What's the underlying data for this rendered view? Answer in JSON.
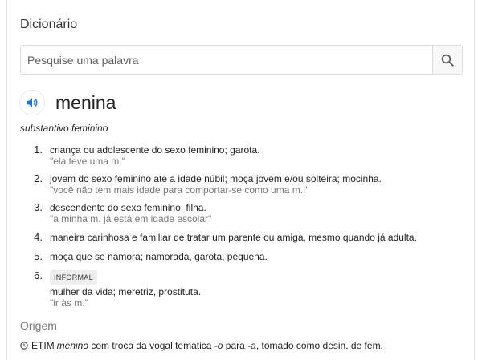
{
  "card": {
    "title": "Dicionário"
  },
  "search": {
    "placeholder": "Pesquise uma palavra",
    "button_icon": "search-icon"
  },
  "entry": {
    "speaker_icon": "speaker-icon",
    "word": "menina",
    "part_of_speech": "substantivo feminino",
    "senses": [
      {
        "num": "1.",
        "definition": "criança ou adolescente do sexo feminino; garota.",
        "example": "\"ela teve uma m.\""
      },
      {
        "num": "2.",
        "definition": "jovem do sexo feminino até a idade núbil; moça jovem e/ou solteira; mocinha.",
        "example": "\"você não tem mais idade para comportar-se como uma m.!\""
      },
      {
        "num": "3.",
        "definition": "descendente do sexo feminino; filha.",
        "example": "\"a minha m. já está em idade escolar\""
      },
      {
        "num": "4.",
        "definition": "maneira carinhosa e familiar de tratar um parente ou amiga, mesmo quando já adulta."
      },
      {
        "num": "5.",
        "definition": "moça que se namora; namorada, garota, pequena."
      },
      {
        "num": "6.",
        "label": "INFORMAL",
        "definition": "mulher da vida; meretriz, prostituta.",
        "example": "\"ir às m.\""
      }
    ]
  },
  "origin": {
    "title": "Origem",
    "info_icon": "info-icon",
    "parts": {
      "prefix": "ETIM ",
      "word": "menino",
      "mid1": " com troca da vogal temática ",
      "v1": "-o",
      "mid2": " para ",
      "v2": "-a",
      "suffix": ", tomado como desin. de fem."
    }
  },
  "colors": {
    "accent": "#1a73e8",
    "muted": "#777777",
    "border": "#dcdcdc"
  }
}
